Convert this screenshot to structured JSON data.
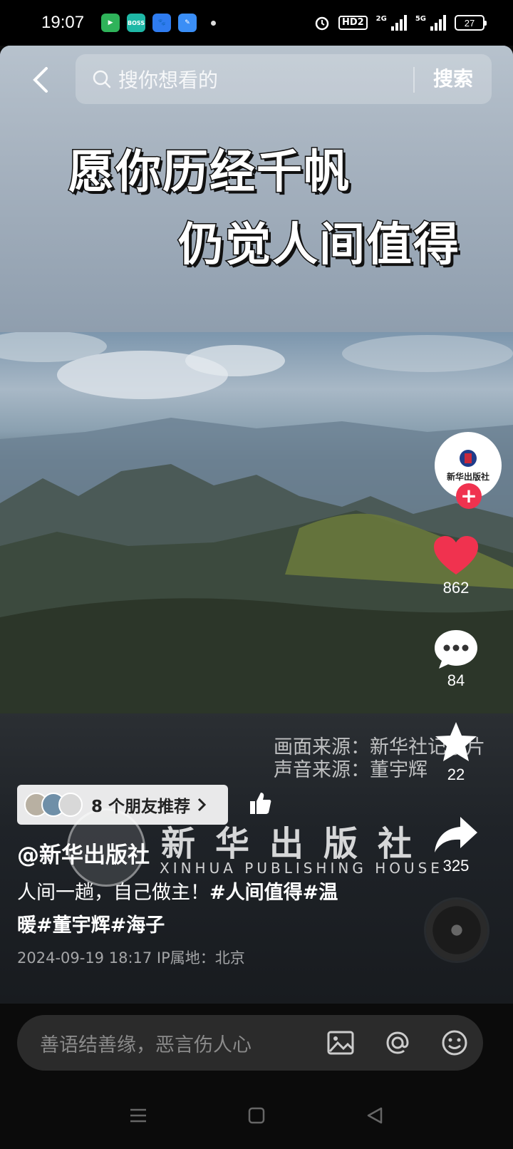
{
  "status_bar": {
    "time": "19:07",
    "hd_label": "HD2",
    "net1": "2G",
    "net2": "5G",
    "battery": "27"
  },
  "search": {
    "placeholder": "搜你想看的",
    "button": "搜索"
  },
  "video": {
    "caption_line1": "愿你历经千帆",
    "caption_line2": "仍觉人间值得",
    "credit_picture": "画面来源：新华社记录片",
    "credit_sound": "声音来源：董宇辉",
    "watermark_cn": "新华出版社",
    "watermark_en": "XINHUA PUBLISHING HOUSE"
  },
  "rail": {
    "avatar_text": "新华出版社",
    "likes": "862",
    "comments": "84",
    "favorites": "22",
    "shares": "325"
  },
  "post": {
    "friends_recommend": "8 个朋友推荐",
    "author": "@新华出版社",
    "desc_text": "人间一趟，自己做主！",
    "tags_line1": "#人间值得#温",
    "tags_line2": "暖#董宇辉#海子",
    "meta": "2024-09-19 18:17  IP属地：北京"
  },
  "comment_bar": {
    "placeholder": "善语结善缘，恶言伤人心"
  },
  "colors": {
    "like": "#f0324f",
    "plus": "#f0324f"
  }
}
